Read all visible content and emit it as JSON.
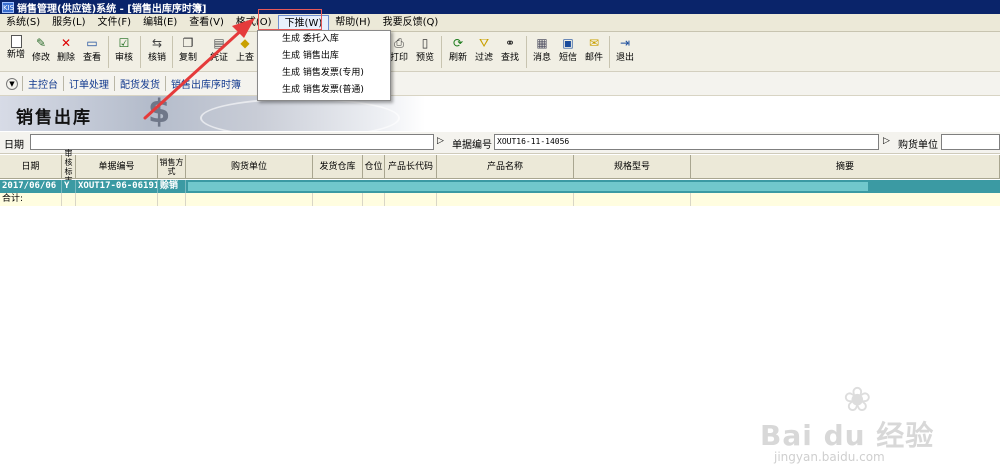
{
  "window": {
    "title": "销售管理(供应链)系统 - [销售出库序时簿]",
    "app_icon": "KIS"
  },
  "menubar": {
    "items": [
      "系统(S)",
      "服务(L)",
      "文件(F)",
      "编辑(E)",
      "查看(V)",
      "格式(O)",
      "下推(W)",
      "帮助(H)",
      "我要反馈(Q)"
    ],
    "active_index": 6
  },
  "toolbar": {
    "buttons": [
      {
        "label": "新增",
        "icon": "new-document-icon"
      },
      {
        "label": "修改",
        "icon": "edit-pencil-icon"
      },
      {
        "label": "删除",
        "icon": "delete-x-icon"
      },
      {
        "label": "查看",
        "icon": "view-icon"
      },
      {
        "label": "审核",
        "icon": "check-approve-icon"
      },
      {
        "label": "核销",
        "icon": "writeoff-icon"
      },
      {
        "label": "复制",
        "icon": "copy-icon"
      },
      {
        "label": "凭证",
        "icon": "voucher-icon"
      },
      {
        "label": "上查",
        "icon": "trace-up-icon"
      },
      {
        "label": "打印",
        "icon": "printer-icon"
      },
      {
        "label": "预览",
        "icon": "preview-icon"
      },
      {
        "label": "刷新",
        "icon": "refresh-icon"
      },
      {
        "label": "过滤",
        "icon": "filter-icon"
      },
      {
        "label": "查找",
        "icon": "binoculars-icon"
      },
      {
        "label": "消息",
        "icon": "message-icon"
      },
      {
        "label": "短信",
        "icon": "sms-icon"
      },
      {
        "label": "邮件",
        "icon": "mail-icon"
      },
      {
        "label": "退出",
        "icon": "exit-icon"
      }
    ]
  },
  "nav": {
    "items": [
      "主控台",
      "订单处理",
      "配货发货",
      "销售出库序时簿"
    ]
  },
  "banner": {
    "title": "销售出库"
  },
  "filter": {
    "date_label": "日期",
    "date_value": "",
    "billno_label": "单据编号",
    "billno_value": "XOUT16-11-14056",
    "buyer_label": "购货单位",
    "buyer_value": ""
  },
  "table": {
    "columns": [
      "日期",
      "审核标志",
      "单据编号",
      "销售方式",
      "购货单位",
      "发货仓库",
      "仓位",
      "产品长代码",
      "产品名称",
      "规格型号",
      "摘要"
    ],
    "row": {
      "date": "2017/06/06",
      "audit": "Y",
      "billno": "XOUT17-06-06191",
      "method": "赊销"
    },
    "total_label": "合计:"
  },
  "dropdown": {
    "items": [
      "生成 委托入库",
      "生成 销售出库",
      "生成 销售发票(专用)",
      "生成 销售发票(普通)"
    ]
  },
  "watermark": {
    "brand": "Bai du 经验",
    "url": "jingyan.baidu.com"
  },
  "colors": {
    "title_bg": "#0a246a",
    "selected_row": "#3b9aa3",
    "annotation_red": "#e85a5a"
  }
}
